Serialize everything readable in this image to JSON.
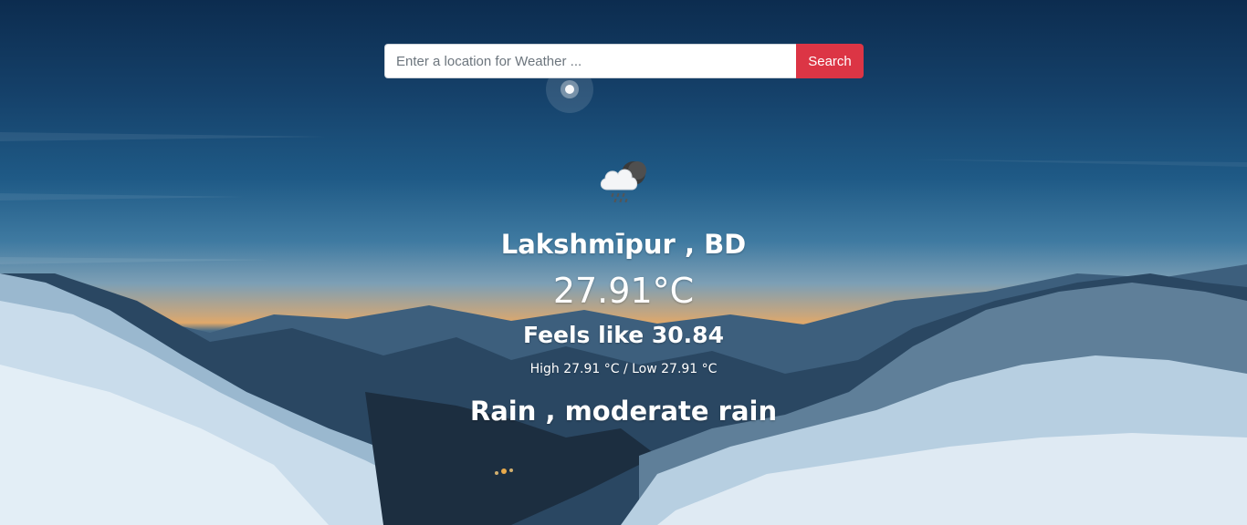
{
  "search": {
    "placeholder": "Enter a location for Weather ...",
    "value": "",
    "button_label": "Search"
  },
  "weather": {
    "icon": "cloud-rain-night-icon",
    "city": "Lakshmīpur , BD",
    "temperature": "27.91°C",
    "feels_like": "Feels like 30.84",
    "high_low": "High 27.91 °C / Low 27.91 °C",
    "description": "Rain , moderate rain"
  },
  "colors": {
    "search_button": "#dc3545",
    "text": "#ffffff"
  }
}
